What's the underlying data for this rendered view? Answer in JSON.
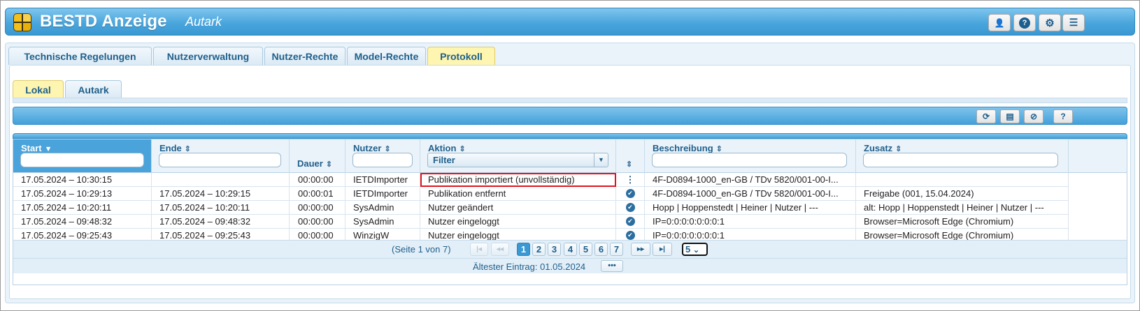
{
  "header": {
    "title": "BESTD Anzeige",
    "subtitle": "Autark",
    "buttons": [
      {
        "icon": "user-icon",
        "glyph": "👤"
      },
      {
        "icon": "help-icon",
        "glyph": "?"
      },
      {
        "icon": "gear-icon",
        "glyph": "⚙"
      },
      {
        "icon": "menu-icon",
        "glyph": "☰"
      }
    ]
  },
  "tabs": [
    {
      "label": "Technische Regelungen",
      "active": false
    },
    {
      "label": "Nutzerverwaltung",
      "active": false
    },
    {
      "label": "Nutzer-Rechte",
      "active": false
    },
    {
      "label": "Model-Rechte",
      "active": false
    },
    {
      "label": "Protokoll",
      "active": true
    }
  ],
  "subtabs": [
    {
      "label": "Lokal",
      "active": true
    },
    {
      "label": "Autark",
      "active": false
    }
  ],
  "toolbar": {
    "buttons": [
      {
        "icon": "refresh-icon",
        "glyph": "⟳"
      },
      {
        "icon": "excel-export-icon",
        "glyph": "▤"
      },
      {
        "icon": "clear-filter-icon",
        "glyph": "⊘"
      },
      {
        "icon": "help-icon",
        "glyph": "?"
      }
    ]
  },
  "table": {
    "columns": [
      {
        "label": "Start",
        "sort": "▼",
        "filter": "input",
        "sorted": true
      },
      {
        "label": "Ende",
        "sort": "⇕",
        "filter": "input"
      },
      {
        "label": "Dauer",
        "sort": "⇕",
        "filter": "none"
      },
      {
        "label": "Nutzer",
        "sort": "⇕",
        "filter": "input"
      },
      {
        "label": "Aktion",
        "sort": "⇕",
        "filter": "select",
        "filter_value": "Filter"
      },
      {
        "label": "",
        "sort": "⇕",
        "filter": "none"
      },
      {
        "label": "Beschreibung",
        "sort": "⇕",
        "filter": "input"
      },
      {
        "label": "Zusatz",
        "sort": "⇕",
        "filter": "input"
      }
    ],
    "rows": [
      {
        "start": "17.05.2024 – 10:30:15",
        "ende": "",
        "dauer": "00:00:00",
        "nutzer": "IETDImporter",
        "aktion": "Publikation importiert (unvollständig)",
        "status": "dots",
        "beschreibung": "4F-D0894-1000_en-GB / TDv 5820/001-00-I...",
        "zusatz": "",
        "highlight": true
      },
      {
        "start": "17.05.2024 – 10:29:13",
        "ende": "17.05.2024 – 10:29:15",
        "dauer": "00:00:01",
        "nutzer": "IETDImporter",
        "aktion": "Publikation entfernt",
        "status": "check",
        "beschreibung": "4F-D0894-1000_en-GB / TDv 5820/001-00-I...",
        "zusatz": "Freigabe (001, 15.04.2024)"
      },
      {
        "start": "17.05.2024 – 10:20:11",
        "ende": "17.05.2024 – 10:20:11",
        "dauer": "00:00:00",
        "nutzer": "SysAdmin",
        "aktion": "Nutzer geändert",
        "status": "check",
        "beschreibung": "Hopp | Hoppenstedt | Heiner | Nutzer | ---",
        "zusatz": "alt: Hopp | Hoppenstedt | Heiner | Nutzer | ---"
      },
      {
        "start": "17.05.2024 – 09:48:32",
        "ende": "17.05.2024 – 09:48:32",
        "dauer": "00:00:00",
        "nutzer": "SysAdmin",
        "aktion": "Nutzer eingeloggt",
        "status": "check",
        "beschreibung": "IP=0:0:0:0:0:0:0:1",
        "zusatz": "Browser=Microsoft Edge (Chromium)"
      },
      {
        "start": "17.05.2024 – 09:25:43",
        "ende": "17.05.2024 – 09:25:43",
        "dauer": "00:00:00",
        "nutzer": "WinzigW",
        "aktion": "Nutzer eingeloggt",
        "status": "check",
        "beschreibung": "IP=0:0:0:0:0:0:0:1",
        "zusatz": "Browser=Microsoft Edge (Chromium)"
      }
    ]
  },
  "pager": {
    "info": "(Seite 1 von 7)",
    "first": "|◂",
    "prev": "◂◂",
    "pages": [
      "1",
      "2",
      "3",
      "4",
      "5",
      "6",
      "7"
    ],
    "current_page": "1",
    "next": "▸▸",
    "last": "▸|",
    "page_size": "5",
    "page_size_caret": "⌄"
  },
  "footer": {
    "info": "Ältester Eintrag: 01.05.2024",
    "more_label": "•••"
  },
  "colors": {
    "accent": "#3a98d2",
    "active_tab": "#fdf5b0",
    "highlight_border": "#e0141e"
  }
}
